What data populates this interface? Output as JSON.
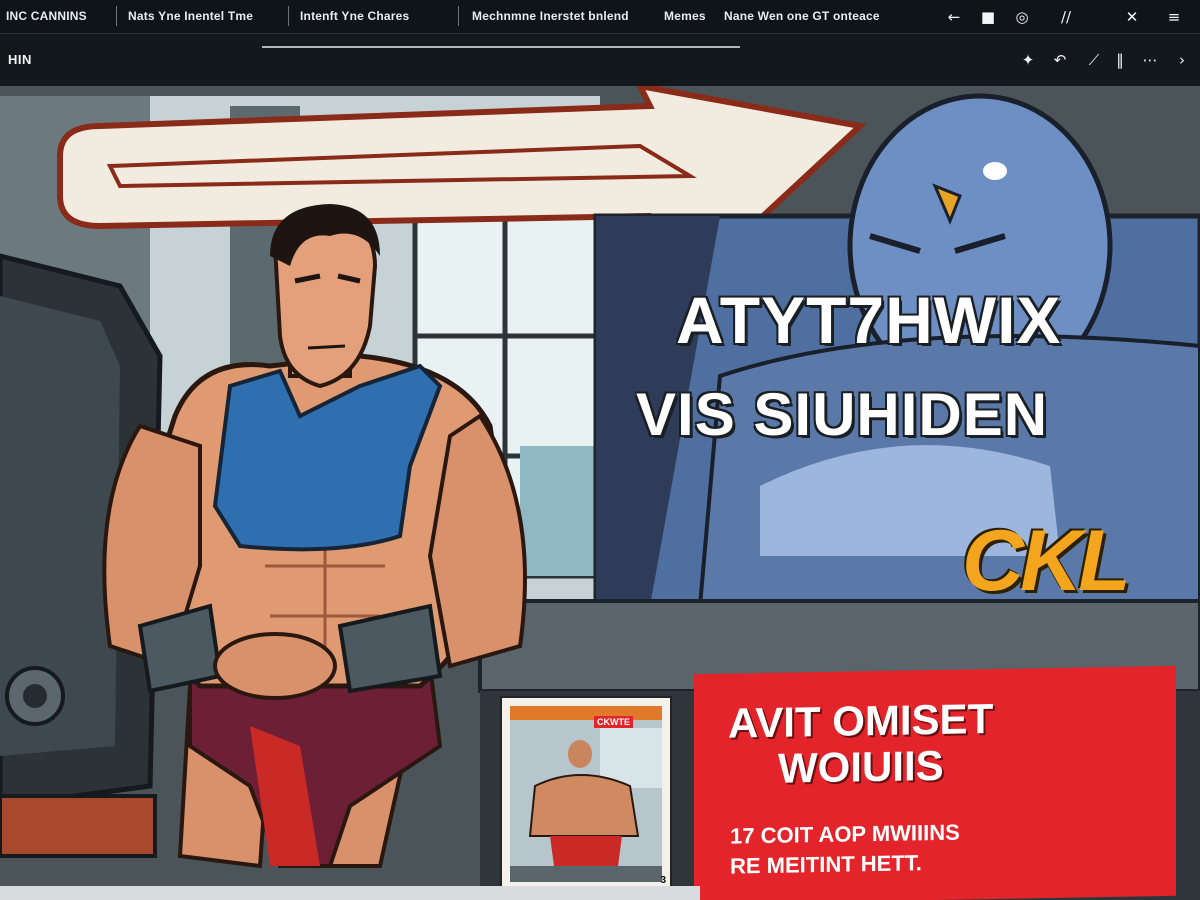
{
  "topbar": {
    "tabs": [
      "INC CANNINS",
      "Nats Yne  Inentel Tme",
      "Intenft Yne  Chares",
      "Mechnmne Inerstet bnlend",
      "Memes",
      "Nane Wen one GT onteace"
    ],
    "icons": [
      "back-arrow-icon",
      "stop-icon",
      "eye-icon",
      "diagonal-lines-icon",
      "close-icon",
      "menu-icon"
    ]
  },
  "secondary_bar": {
    "title": "HIN",
    "icons": [
      "pin-icon",
      "undo-icon",
      "forward-slash-icon",
      "split-icon",
      "more-icon",
      "chevron-right-icon"
    ]
  },
  "artwork": {
    "headline_line1": "ATYT7HWIX",
    "headline_line2": "VIS SIUHIDEN",
    "logo_text": "CKL",
    "promo": {
      "line1": "AVIT OMISET",
      "line2": "WOIUIIS",
      "line3": "17 COIT AOP MWIIINS",
      "line4": "RE MEITINT HETT."
    },
    "thumbnail": {
      "label": "CKWTE",
      "badge": "3"
    },
    "colors": {
      "accent_red": "#e3252b",
      "logo_orange": "#f3a51d",
      "villain_blue": "#5a78a8",
      "tank_blue": "#2f6fb0"
    }
  }
}
